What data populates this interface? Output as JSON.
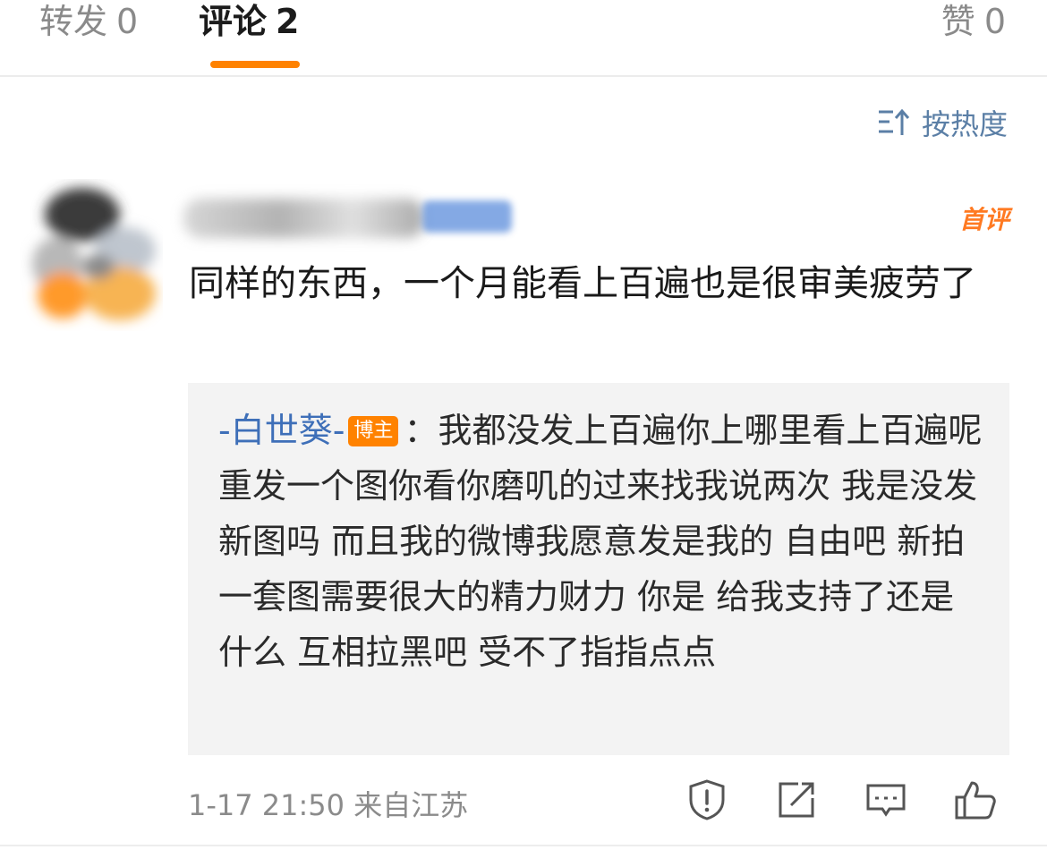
{
  "tabs": {
    "repost": {
      "label": "转发",
      "count": "0"
    },
    "comment": {
      "label": "评论",
      "count": "2"
    },
    "like": {
      "label": "赞",
      "count": "0"
    }
  },
  "sort": {
    "label": "按热度",
    "icon": "sort-icon"
  },
  "comment": {
    "first_comment_tag": "首评",
    "text": "同样的东西，一个月能看上百遍也是很审美疲劳了",
    "reply": {
      "author": "-白世葵-",
      "badge": "博主",
      "separator": "：",
      "text": "我都没发上百遍你上哪里看上百遍呢 重发一个图你看你磨叽的过来找我说两次 我是没发新图吗 而且我的微博我愿意发是我的 自由吧 新拍一套图需要很大的精力财力 你是 给我支持了还是什么 互相拉黑吧 受不了指指点点"
    },
    "time": "1-17 21:50",
    "location": "来自江苏",
    "actions": [
      "report-icon",
      "repost-icon",
      "comment-icon",
      "like-icon"
    ]
  },
  "colors": {
    "accent": "#ff8200",
    "link": "#3e6fb8",
    "sort": "#5b7fa6",
    "reply_bg": "#f3f3f3"
  }
}
